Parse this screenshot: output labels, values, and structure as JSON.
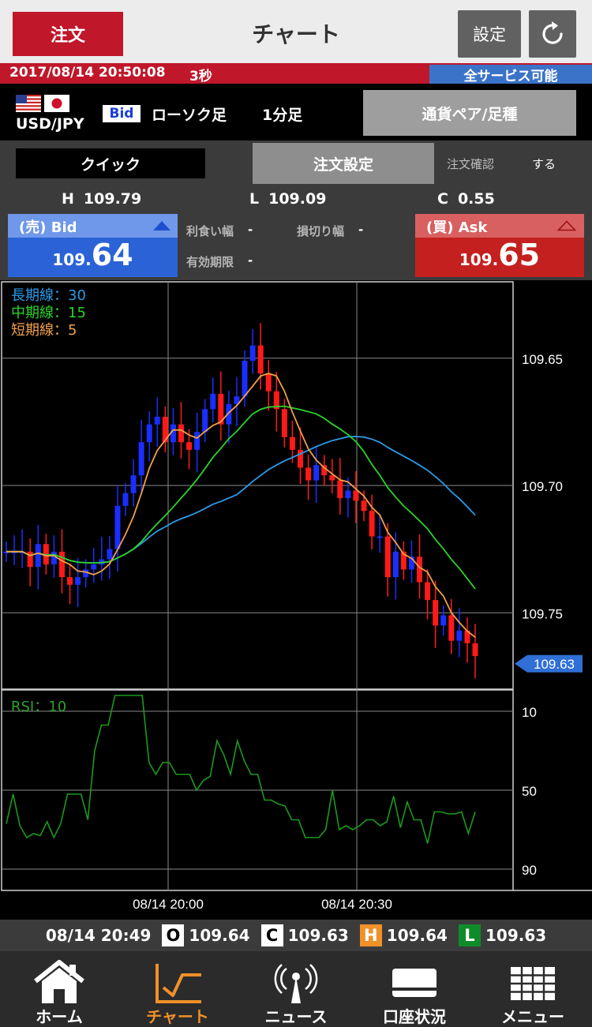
{
  "header": {
    "order_label": "注文",
    "title": "チャート",
    "settings_label": "設定"
  },
  "status": {
    "datetime": "2017/08/14 20:50:08",
    "interval": "3秒",
    "service": "全サービス可能"
  },
  "info": {
    "pair": "USD/JPY",
    "rate_type": "Bid",
    "chart_type": "ローソク足",
    "timeframe": "1分足",
    "pair_button": "通貨ペア/足種"
  },
  "order": {
    "quick_label": "クイック",
    "settings_label": "注文設定",
    "confirm_label": "注文確認",
    "confirm_value": "する",
    "high_key": "H",
    "high": "109.79",
    "low_key": "L",
    "low": "109.09",
    "change_key": "C",
    "change": "0.55",
    "sell": {
      "label": "(売) Bid",
      "price_small": "109.",
      "price_big": "64"
    },
    "buy": {
      "label": "(買) Ask",
      "price_small": "109.",
      "price_big": "65"
    },
    "take_profit_label": "利食い幅",
    "take_profit_value": "-",
    "stop_loss_label": "損切り幅",
    "stop_loss_value": "-",
    "expiry_label": "有効期限",
    "expiry_value": "-"
  },
  "chart": {
    "legend": {
      "long": "長期線：30",
      "mid": "中期線：15",
      "short": "短期線：5"
    },
    "price_ticks": [
      "109.75",
      "109.70",
      "109.65"
    ],
    "current_price": "109.63",
    "rsi_label": "RSI：10",
    "rsi_ticks": [
      "90",
      "50",
      "10"
    ],
    "time_labels": [
      "08/14 20:00",
      "08/14 20:30"
    ],
    "colors": {
      "up": "#ff1a1a",
      "down": "#1a2eff",
      "long": "#2b9be8",
      "mid": "#2bd32b",
      "short": "#f0a04a",
      "rsi": "#1c9a1c"
    }
  },
  "chart_data": [
    {
      "type": "candlestick",
      "title": "",
      "ylim": [
        109.62,
        109.78
      ],
      "yticks": [
        109.65,
        109.7,
        109.75
      ],
      "xticks": [
        "08/14 20:00",
        "08/14 20:30"
      ],
      "candles_close": [
        109.674,
        109.674,
        109.674,
        109.668,
        109.677,
        109.669,
        109.674,
        109.664,
        109.661,
        109.664,
        109.667,
        109.669,
        109.671,
        109.675,
        109.692,
        109.697,
        109.704,
        109.717,
        109.724,
        109.727,
        109.717,
        109.724,
        109.717,
        109.714,
        109.721,
        109.73,
        109.736,
        109.724,
        109.732,
        109.735,
        109.749,
        109.755,
        109.744,
        109.737,
        109.73,
        109.719,
        109.714,
        109.707,
        109.702,
        109.708,
        109.704,
        109.702,
        109.695,
        109.698,
        109.694,
        109.69,
        109.68,
        109.68,
        109.664,
        109.674,
        109.667,
        109.672,
        109.662,
        109.655,
        109.645,
        109.649,
        109.639,
        109.643,
        109.638,
        109.633
      ],
      "series": [
        {
          "name": "長期線：30"
        },
        {
          "name": "中期線：15"
        },
        {
          "name": "短期線：5"
        }
      ]
    },
    {
      "type": "line",
      "title": "RSI：10",
      "ylim": [
        0,
        100
      ],
      "yticks": [
        10,
        50,
        90
      ],
      "values": [
        33,
        48,
        32,
        26,
        28,
        27,
        34,
        26,
        33,
        48,
        48,
        48,
        35,
        70,
        83,
        83,
        98,
        98,
        98,
        98,
        98,
        64,
        58,
        64,
        64,
        58,
        58,
        58,
        50,
        55,
        57,
        75,
        68,
        58,
        75,
        65,
        58,
        58,
        45,
        45,
        43,
        42,
        35,
        35,
        26,
        26,
        26,
        30,
        50,
        30,
        32,
        30,
        32,
        35,
        35,
        32,
        34,
        47,
        31,
        44,
        35,
        35,
        23,
        39,
        39,
        38,
        38,
        39,
        28,
        39
      ]
    }
  ],
  "summary": {
    "time": "08/14 20:49",
    "o_key": "O",
    "o": "109.64",
    "c_key": "C",
    "c": "109.63",
    "h_key": "H",
    "h": "109.64",
    "l_key": "L",
    "l": "109.63"
  },
  "nav": {
    "home": "ホーム",
    "chart": "チャート",
    "news": "ニュース",
    "account": "口座状況",
    "menu": "メニュー"
  }
}
